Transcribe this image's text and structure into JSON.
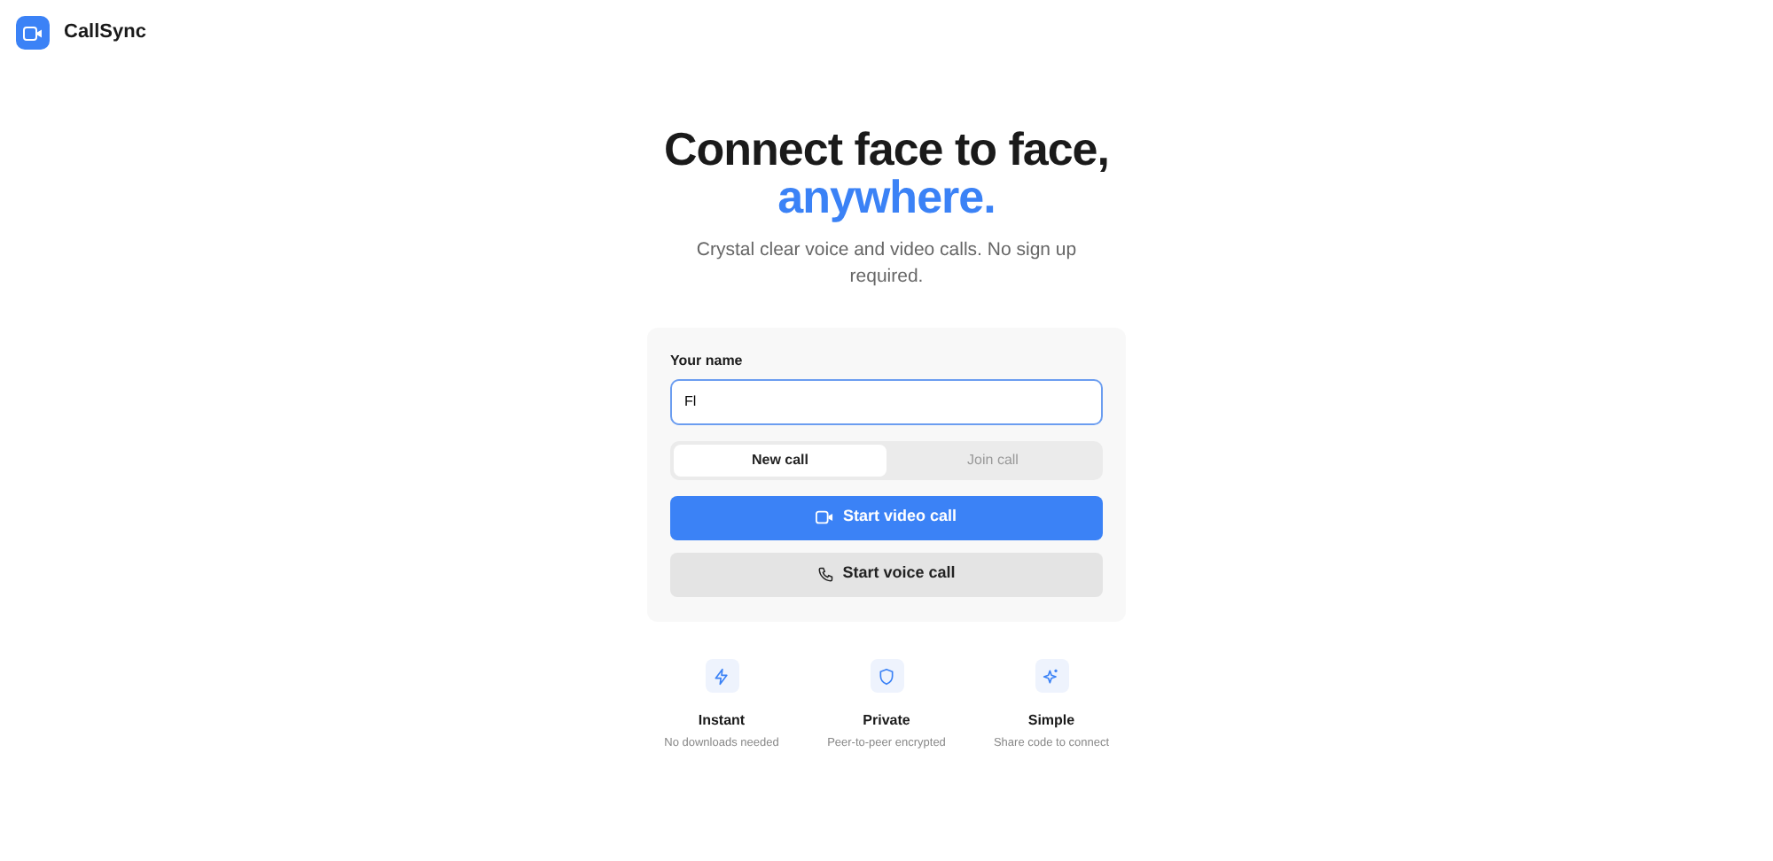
{
  "brand": {
    "name": "CallSync"
  },
  "hero": {
    "headline": "Connect face to face,",
    "headline_accent": "anywhere.",
    "subtitle": "Crystal clear voice and video calls. No sign up required."
  },
  "form": {
    "name_label": "Your name",
    "name_value": "Fl",
    "modes": [
      {
        "label": "New call",
        "selected": true
      },
      {
        "label": "Join call",
        "selected": false
      }
    ],
    "buttons": [
      {
        "kind": "video",
        "label": "Start video call"
      },
      {
        "kind": "voice",
        "label": "Start voice call"
      }
    ]
  },
  "features": [
    {
      "kind": "bolt",
      "title": "Instant",
      "caption": "No downloads needed"
    },
    {
      "kind": "shield",
      "title": "Private",
      "caption": "Peer-to-peer encrypted"
    },
    {
      "kind": "sparkle",
      "title": "Simple",
      "caption": "Share code to connect"
    }
  ]
}
